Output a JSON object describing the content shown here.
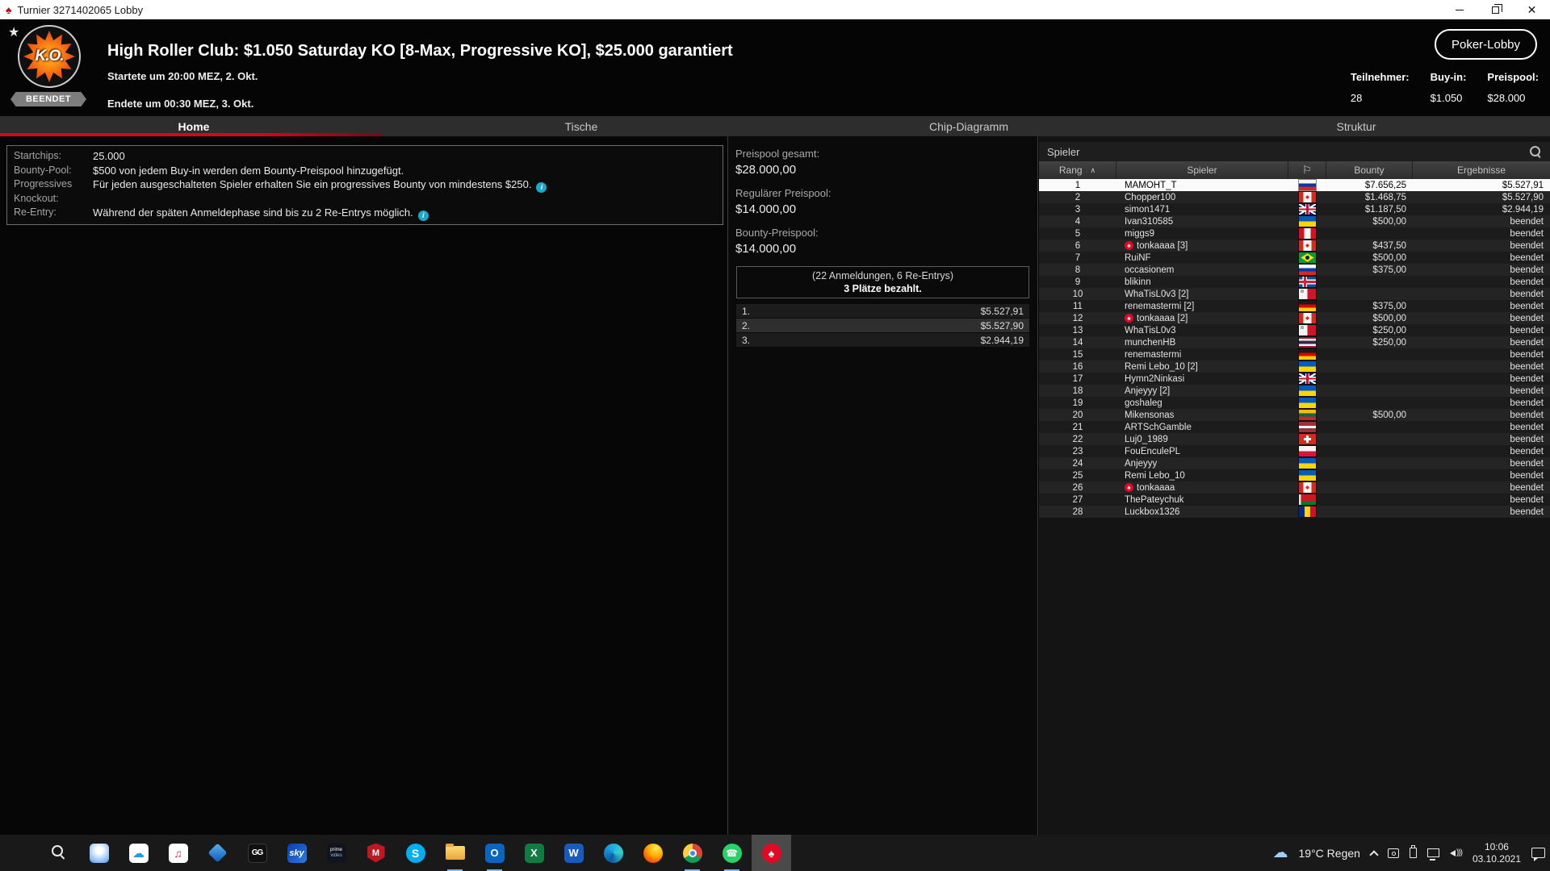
{
  "window": {
    "title": "Turnier 3271402065 Lobby"
  },
  "header": {
    "badge": "BEENDET",
    "logo_text": "K.O.",
    "title": "High Roller Club: $1.050 Saturday KO [8-Max, Progressive KO], $25.000 garantiert",
    "started": "Startete um 20:00 MEZ, 2. Okt.",
    "ended": "Endete um 00:30 MEZ, 3. Okt.",
    "lobby_button": "Poker-Lobby",
    "stats": [
      {
        "label": "Teilnehmer:",
        "value": "28"
      },
      {
        "label": "Buy-in:",
        "value": "$1.050"
      },
      {
        "label": "Preispool:",
        "value": "$28.000"
      }
    ]
  },
  "tabs": [
    {
      "id": "tab-home",
      "label": "Home",
      "active": true
    },
    {
      "id": "tab-tische",
      "label": "Tische"
    },
    {
      "id": "tab-chip-diagramm",
      "label": "Chip-Diagramm"
    },
    {
      "id": "tab-struktur",
      "label": "Struktur"
    }
  ],
  "tournament_info": {
    "rows": [
      {
        "label": "Startchips:",
        "value": "25.000"
      },
      {
        "label": "Bounty-Pool:",
        "value": "$500 von jedem Buy-in werden dem Bounty-Preispool hinzugefügt."
      },
      {
        "label": "Progressives Knockout:",
        "value": "Für jeden ausgeschalteten Spieler erhalten Sie ein progressives Bounty von mindestens $250.",
        "info": true
      },
      {
        "label": "Re-Entry:",
        "value": "Während der späten Anmeldephase sind bis zu 2 Re-Entrys möglich.",
        "info": true
      }
    ]
  },
  "prizepool": {
    "total_label": "Preispool gesamt:",
    "total": "$28.000,00",
    "regular_label": "Regulärer Preispool:",
    "regular": "$14.000,00",
    "bounty_label": "Bounty-Preispool:",
    "bounty": "$14.000,00",
    "entries_line": "(22 Anmeldungen, 6 Re-Entrys)",
    "paid_line": "3 Plätze bezahlt.",
    "places": [
      {
        "rank": "1.",
        "amount": "$5.527,91"
      },
      {
        "rank": "2.",
        "amount": "$5.527,90",
        "highlight": true
      },
      {
        "rank": "3.",
        "amount": "$2.944,19"
      }
    ]
  },
  "players": {
    "panel_title": "Spieler",
    "columns": {
      "rank": "Rang",
      "player": "Spieler",
      "bounty": "Bounty",
      "results": "Ergebnisse"
    },
    "rows": [
      {
        "rank": "1",
        "name": "MAMOHT_T",
        "flag": "ru",
        "bounty": "$7.656,25",
        "result": "$5.527,91",
        "winner": true
      },
      {
        "rank": "2",
        "name": "Chopper100",
        "flag": "ca",
        "bounty": "$1.468,75",
        "result": "$5.527,90"
      },
      {
        "rank": "3",
        "name": "simon1471",
        "flag": "gb",
        "bounty": "$1.187,50",
        "result": "$2.944,19"
      },
      {
        "rank": "4",
        "name": "Ivan310585",
        "flag": "ua",
        "bounty": "$500,00",
        "result": "beendet"
      },
      {
        "rank": "5",
        "name": "miggs9",
        "flag": "pe",
        "bounty": "",
        "result": "beendet"
      },
      {
        "rank": "6",
        "name": "tonkaaaa [3]",
        "flag": "ca",
        "spade": true,
        "bounty": "$437,50",
        "result": "beendet"
      },
      {
        "rank": "7",
        "name": "RuiNF",
        "flag": "br",
        "bounty": "$500,00",
        "result": "beendet"
      },
      {
        "rank": "8",
        "name": "occasionem",
        "flag": "ru",
        "bounty": "$375,00",
        "result": "beendet"
      },
      {
        "rank": "9",
        "name": "blikinn",
        "flag": "is",
        "bounty": "",
        "result": "beendet"
      },
      {
        "rank": "10",
        "name": "WhaTisL0v3 [2]",
        "flag": "mt",
        "bounty": "",
        "result": "beendet"
      },
      {
        "rank": "11",
        "name": "renemastermi [2]",
        "flag": "de",
        "bounty": "$375,00",
        "result": "beendet"
      },
      {
        "rank": "12",
        "name": "tonkaaaa [2]",
        "flag": "ca",
        "spade": true,
        "bounty": "$500,00",
        "result": "beendet"
      },
      {
        "rank": "13",
        "name": "WhaTisL0v3",
        "flag": "mt",
        "bounty": "$250,00",
        "result": "beendet"
      },
      {
        "rank": "14",
        "name": "munchenHB",
        "flag": "th",
        "bounty": "$250,00",
        "result": "beendet"
      },
      {
        "rank": "15",
        "name": "renemastermi",
        "flag": "de",
        "bounty": "",
        "result": "beendet"
      },
      {
        "rank": "16",
        "name": "Remi Lebo_10 [2]",
        "flag": "ua",
        "bounty": "",
        "result": "beendet"
      },
      {
        "rank": "17",
        "name": "Hymn2Ninkasi",
        "flag": "gb",
        "bounty": "",
        "result": "beendet"
      },
      {
        "rank": "18",
        "name": "Anjeyyy [2]",
        "flag": "ua",
        "bounty": "",
        "result": "beendet"
      },
      {
        "rank": "19",
        "name": "goshaleg",
        "flag": "ua",
        "bounty": "",
        "result": "beendet"
      },
      {
        "rank": "20",
        "name": "Mikensonas",
        "flag": "lt",
        "bounty": "$500,00",
        "result": "beendet"
      },
      {
        "rank": "21",
        "name": "ARTSchGamble",
        "flag": "lv",
        "bounty": "",
        "result": "beendet"
      },
      {
        "rank": "22",
        "name": "Luj0_1989",
        "flag": "ch",
        "bounty": "",
        "result": "beendet"
      },
      {
        "rank": "23",
        "name": "FouEnculePL",
        "flag": "pl",
        "bounty": "",
        "result": "beendet"
      },
      {
        "rank": "24",
        "name": "Anjeyyy",
        "flag": "ua",
        "bounty": "",
        "result": "beendet"
      },
      {
        "rank": "25",
        "name": "Remi Lebo_10",
        "flag": "ua",
        "bounty": "",
        "result": "beendet"
      },
      {
        "rank": "26",
        "name": "tonkaaaa",
        "flag": "ca",
        "spade": true,
        "bounty": "",
        "result": "beendet"
      },
      {
        "rank": "27",
        "name": "ThePateychuk",
        "flag": "by",
        "bounty": "",
        "result": "beendet"
      },
      {
        "rank": "28",
        "name": "Luckbox1326",
        "flag": "ro",
        "bounty": "",
        "result": "beendet"
      }
    ]
  },
  "taskbar": {
    "apps": [
      {
        "icon": "start",
        "name": "start-button"
      },
      {
        "icon": "search",
        "name": "taskbar-search-icon"
      },
      {
        "icon": "people",
        "name": "people-app-icon"
      },
      {
        "icon": "icloud",
        "name": "icloud-icon",
        "glyph": "☁"
      },
      {
        "icon": "applemusic",
        "name": "apple-music-icon",
        "glyph": "♫"
      },
      {
        "icon": "bluediamond",
        "name": "blue-diamond-app-icon"
      },
      {
        "icon": "ggpoker",
        "name": "ggpoker-icon",
        "glyph": "GG"
      },
      {
        "icon": "sky",
        "name": "sky-icon",
        "glyph": "sky"
      },
      {
        "icon": "primevideo",
        "name": "prime-video-icon",
        "glyph": "prime",
        "glyph2": "video"
      },
      {
        "icon": "mcafee",
        "name": "mcafee-icon",
        "glyph": "M"
      },
      {
        "icon": "skype",
        "name": "skype-icon",
        "glyph": "S"
      },
      {
        "icon": "explorer",
        "name": "file-explorer-icon",
        "open": true
      },
      {
        "icon": "outlook",
        "name": "outlook-icon",
        "glyph": "O",
        "open": true
      },
      {
        "icon": "excel",
        "name": "excel-icon",
        "glyph": "X"
      },
      {
        "icon": "word",
        "name": "word-icon",
        "glyph": "W"
      },
      {
        "icon": "edge",
        "name": "edge-icon"
      },
      {
        "icon": "firefox",
        "name": "firefox-icon"
      },
      {
        "icon": "chrome",
        "name": "chrome-icon",
        "open": true
      },
      {
        "icon": "whatsapp",
        "name": "whatsapp-icon",
        "glyph": "☎",
        "open": true
      },
      {
        "icon": "pokerstars",
        "name": "pokerstars-icon",
        "glyph": "♠",
        "active": true
      }
    ],
    "tray": {
      "weather": "19°C Regen",
      "time": "10:06",
      "date": "03.10.2021"
    }
  },
  "icons": {
    "spade": "♠",
    "star": "★",
    "flag_header": "⚐",
    "sort_caret": "∧",
    "info": "i",
    "close": "✕"
  },
  "colors": {
    "accent_red": "#d70022",
    "info_cyan": "#18a9cc",
    "winner_bg": "#fafafa"
  }
}
